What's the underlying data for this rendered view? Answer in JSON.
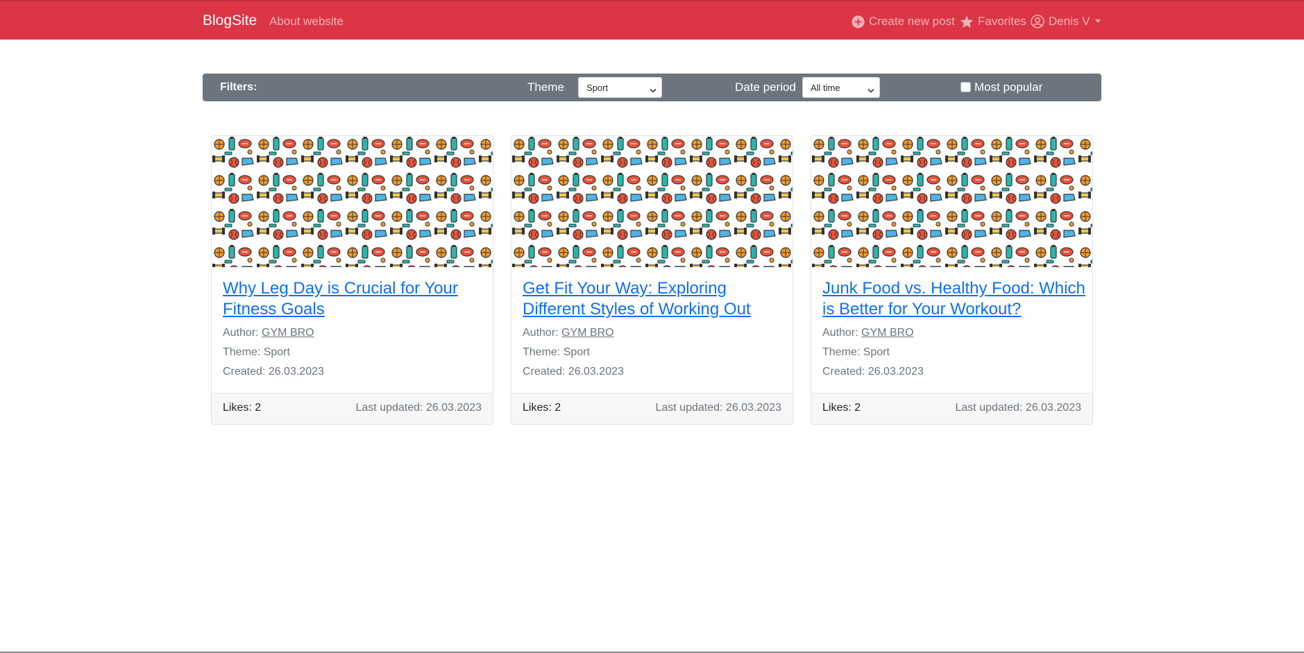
{
  "nav": {
    "brand": "BlogSite",
    "about": "About website",
    "create": "Create new post",
    "favorites": "Favorites",
    "user": "Denis V",
    "icons": {
      "create": "plus-circle-icon",
      "favorites": "star-icon",
      "user": "user-circle-icon",
      "caret": "caret-down-icon"
    }
  },
  "filters": {
    "label": "Filters:",
    "theme_label": "Theme",
    "theme_value": "Sport",
    "date_label": "Date period",
    "date_value": "All time",
    "popular_label": "Most popular",
    "popular_checked": false
  },
  "cards": [
    {
      "title": "Why Leg Day is Crucial for Your Fitness Goals",
      "author_label": "Author:",
      "author": "GYM BRO",
      "theme": "Theme: Sport",
      "created": "Created: 26.03.2023",
      "likes": "Likes: 2",
      "updated": "Last updated: 26.03.2023"
    },
    {
      "title": "Get Fit Your Way: Exploring Different Styles of Working Out",
      "author_label": "Author:",
      "author": "GYM BRO",
      "theme": "Theme: Sport",
      "created": "Created: 26.03.2023",
      "likes": "Likes: 2",
      "updated": "Last updated: 26.03.2023"
    },
    {
      "title": "Junk Food vs. Healthy Food: Which is Better for Your Workout?",
      "author_label": "Author:",
      "author": "GYM BRO",
      "theme": "Theme: Sport",
      "created": "Created: 26.03.2023",
      "likes": "Likes: 2",
      "updated": "Last updated: 26.03.2023"
    }
  ],
  "colors": {
    "navbar": "#dc3545",
    "filter_bar": "#6c757d",
    "link": "#0d6efd",
    "muted": "#6c757d"
  }
}
